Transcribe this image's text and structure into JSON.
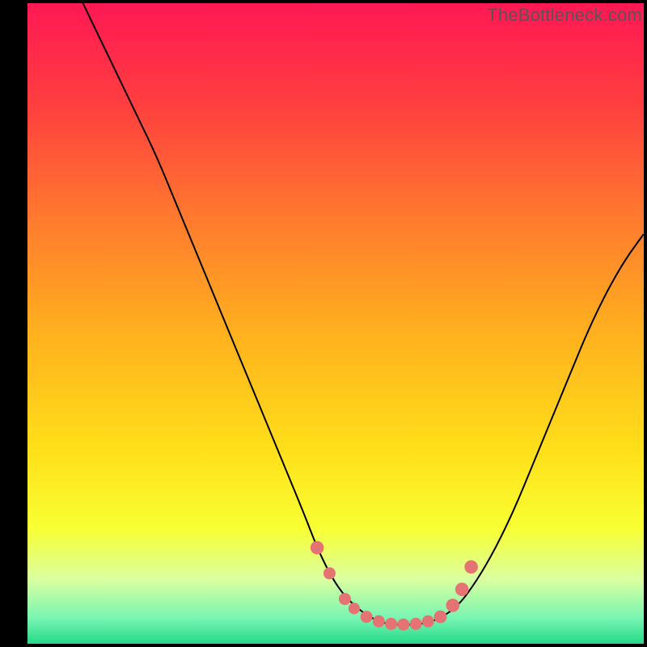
{
  "watermark": "TheBottleneck.com",
  "colors": {
    "background": "#000000",
    "curve": "#000000",
    "marker": "#e57373",
    "gradient_stops": [
      {
        "offset": 0,
        "color": "#ff1854"
      },
      {
        "offset": 16,
        "color": "#ff3f3f"
      },
      {
        "offset": 34,
        "color": "#ff7b2e"
      },
      {
        "offset": 52,
        "color": "#ffb21e"
      },
      {
        "offset": 70,
        "color": "#ffe01a"
      },
      {
        "offset": 82,
        "color": "#f8ff33"
      },
      {
        "offset": 90,
        "color": "#daffa0"
      },
      {
        "offset": 96,
        "color": "#78f5b2"
      },
      {
        "offset": 100,
        "color": "#25d989"
      }
    ]
  },
  "chart_data": {
    "type": "line",
    "title": "",
    "xlabel": "",
    "ylabel": "",
    "xlim": [
      0,
      100
    ],
    "ylim": [
      0,
      100
    ],
    "series": [
      {
        "name": "bottleneck-curve",
        "x": [
          9,
          12,
          15,
          18,
          21,
          24,
          27,
          30,
          33,
          36,
          39,
          42,
          45,
          47,
          49,
          51,
          53,
          55,
          57,
          59,
          61,
          63,
          65,
          67,
          70,
          73,
          76,
          79,
          82,
          85,
          88,
          91,
          94,
          97,
          100
        ],
        "values": [
          100,
          94,
          88,
          82,
          76,
          69,
          62,
          55,
          48,
          41,
          34,
          27,
          20,
          15,
          11,
          8,
          6,
          4.5,
          3.5,
          3,
          3,
          3,
          3.3,
          4,
          6,
          10,
          15,
          21,
          28,
          35,
          42,
          49,
          55,
          60,
          64
        ]
      }
    ],
    "markers": {
      "name": "optimal-range",
      "color": "#e57373",
      "points": [
        {
          "x": 47,
          "y": 15,
          "r": 1.2
        },
        {
          "x": 49,
          "y": 11,
          "r": 1.0
        },
        {
          "x": 51.5,
          "y": 7,
          "r": 1.0
        },
        {
          "x": 53,
          "y": 5.5,
          "r": 0.9
        },
        {
          "x": 55,
          "y": 4.2,
          "r": 1.0
        },
        {
          "x": 57,
          "y": 3.5,
          "r": 1.0
        },
        {
          "x": 59,
          "y": 3.1,
          "r": 1.0
        },
        {
          "x": 61,
          "y": 3.0,
          "r": 1.0
        },
        {
          "x": 63,
          "y": 3.1,
          "r": 1.0
        },
        {
          "x": 65,
          "y": 3.5,
          "r": 1.0
        },
        {
          "x": 67,
          "y": 4.2,
          "r": 1.1
        },
        {
          "x": 69,
          "y": 6.0,
          "r": 1.2
        },
        {
          "x": 70.5,
          "y": 8.5,
          "r": 1.2
        },
        {
          "x": 72,
          "y": 12,
          "r": 1.2
        }
      ]
    }
  }
}
